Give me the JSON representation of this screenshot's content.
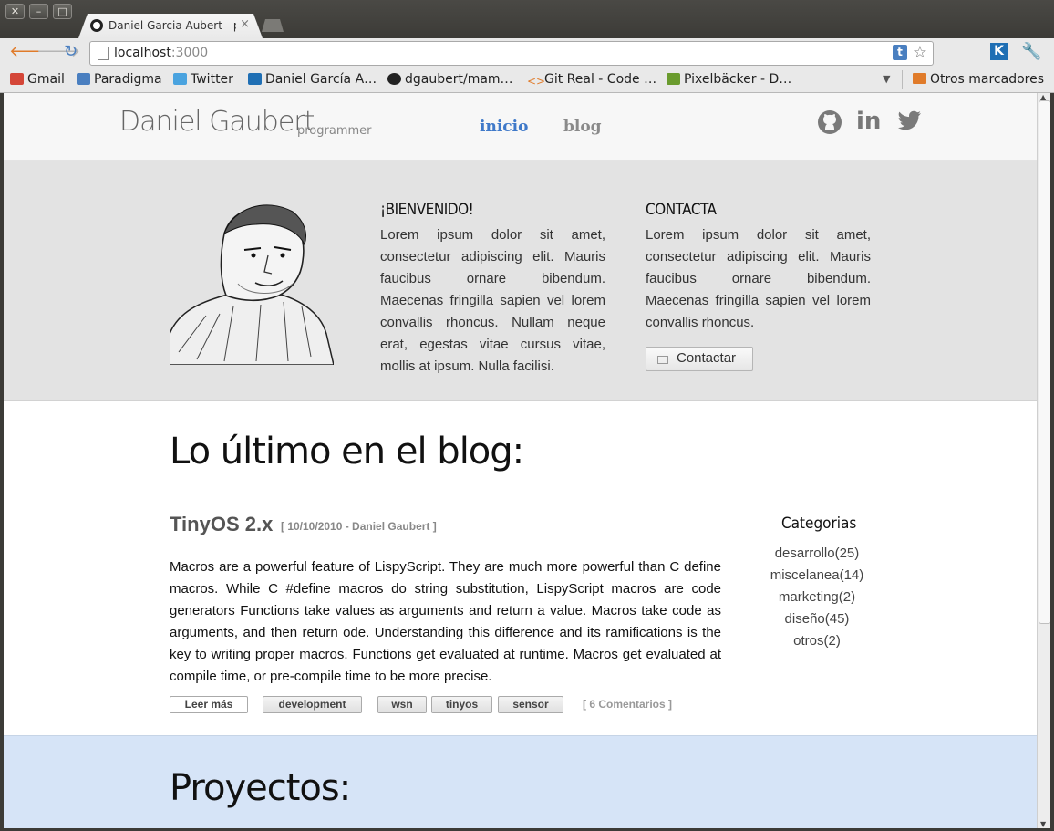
{
  "browser": {
    "window_buttons": [
      "✕",
      "–",
      "□"
    ],
    "tab_title": "Daniel Garcia Aubert - pro",
    "tab_close": "×",
    "url_host": "localhost",
    "url_port": ":3000",
    "ext_t": "t",
    "ext_k": "K",
    "bookmarks": [
      {
        "label": "Gmail",
        "icon": "gmail-icon",
        "color": "#d44638"
      },
      {
        "label": "Paradigma",
        "icon": "google-plus-icon",
        "color": "#4a7fc0"
      },
      {
        "label": "Twitter",
        "icon": "twitter-icon",
        "color": "#4aa3df"
      },
      {
        "label": "Daniel García A…",
        "icon": "linkedin-icon",
        "color": "#1f6fb4"
      },
      {
        "label": "dgaubert/mam…",
        "icon": "github-icon",
        "color": "#222222"
      },
      {
        "label": "Git Real - Code …",
        "icon": "code-icon",
        "color": "#e07b2a"
      },
      {
        "label": "Pixelbäcker - D…",
        "icon": "pixel-icon",
        "color": "#6a9b2e"
      }
    ],
    "other_bookmarks": "Otros marcadores"
  },
  "site": {
    "logo": "Daniel Gaubert",
    "tagline": "programmer",
    "nav": [
      {
        "label": "inicio",
        "color": "#3f79c9"
      },
      {
        "label": "blog",
        "color": "#8a8a8a"
      }
    ],
    "social": [
      "github-icon",
      "linkedin-icon",
      "twitter-icon"
    ]
  },
  "intro": {
    "welcome_title": "¡BIENVENIDO!",
    "welcome_text": "Lorem ipsum dolor sit amet, consectetur adipiscing elit. Mauris faucibus ornare bibendum. Maecenas fringilla sapien vel lorem convallis rhoncus. Nullam neque erat, egestas vitae cursus vitae, mollis at ipsum. Nulla facilisi.",
    "contact_title": "CONTACTA",
    "contact_text": "Lorem ipsum dolor sit amet, consectetur adipiscing elit. Mauris faucibus ornare bibendum. Maecenas fringilla sapien vel lorem convallis rhoncus.",
    "contact_button": "Contactar"
  },
  "blog": {
    "section_title": "Lo último en el blog:",
    "post": {
      "title": "TinyOS 2.x",
      "meta": "[ 10/10/2010 - Daniel Gaubert ]",
      "body": "Macros are a powerful feature of LispyScript. They are much more powerful than C define macros. While C #define macros do string substitution, LispyScript macros are code generators Functions take values as arguments and return a value. Macros take code as arguments, and then return ode. Understanding this difference and its ramifications is the key to writing proper macros. Functions get evaluated at runtime. Macros get evaluated at compile time, or pre-compile time to be more precise.",
      "read_more": "Leer más",
      "tags": [
        "development",
        "wsn",
        "tinyos",
        "sensor"
      ],
      "comments": "[ 6 Comentarios ]"
    },
    "categories_title": "Categorias",
    "categories": [
      "desarrollo(25)",
      "miscelanea(14)",
      "marketing(2)",
      "diseño(45)",
      "otros(2)"
    ]
  },
  "projects": {
    "section_title": "Proyectos:"
  }
}
